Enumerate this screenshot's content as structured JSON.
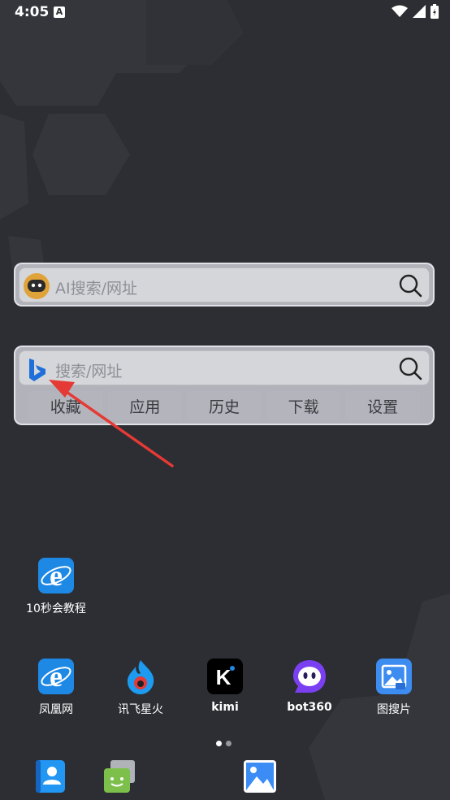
{
  "status_bar": {
    "time": "4:05",
    "indicator": "A"
  },
  "ai_search": {
    "placeholder": "AI搜索/网址"
  },
  "web_search": {
    "placeholder": "搜索/网址",
    "tabs": [
      "收藏",
      "应用",
      "历史",
      "下载",
      "设置"
    ]
  },
  "apps": {
    "single": {
      "label": "10秒会教程",
      "icon": "ie-browser-icon"
    },
    "row": [
      {
        "label": "凤凰网",
        "icon": "ie-browser-icon"
      },
      {
        "label": "讯飞星火",
        "icon": "spark-icon"
      },
      {
        "label": "kimi",
        "icon": "kimi-icon"
      },
      {
        "label": "bot360",
        "icon": "bot360-icon"
      },
      {
        "label": "图搜片",
        "icon": "image-search-icon"
      }
    ]
  },
  "dock": [
    {
      "icon": "contacts-icon"
    },
    {
      "icon": "messages-icon"
    },
    {
      "icon": "gallery-icon"
    }
  ],
  "colors": {
    "accent_blue": "#1e88e5",
    "arrow_red": "#e53935"
  }
}
